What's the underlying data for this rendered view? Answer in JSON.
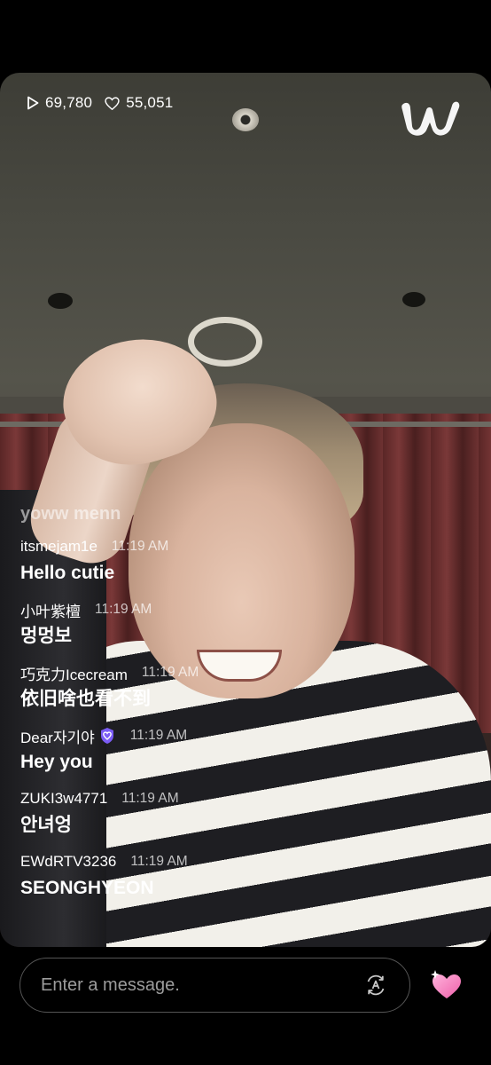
{
  "stats": {
    "views": "69,780",
    "likes": "55,051"
  },
  "chat": {
    "faded_message": "yoww menn",
    "messages": [
      {
        "user": "itsmejam1e",
        "time": "11:19 AM",
        "text": "Hello cutie"
      },
      {
        "user": "小叶紫檀",
        "time": "11:19 AM",
        "text": "멍멍보"
      },
      {
        "user": "巧克力Icecream",
        "time": "11:19 AM",
        "text": "依旧啥也看不到"
      },
      {
        "user": "Dear자기야",
        "time": "11:19 AM",
        "text": "Hey you",
        "badge": "heart-badge-icon"
      },
      {
        "user": "ZUKI3w4771",
        "time": "11:19 AM",
        "text": "안녀엉"
      },
      {
        "user": "EWdRTV3236",
        "time": "11:19 AM",
        "text": "SEONGHYEON"
      }
    ]
  },
  "input": {
    "placeholder": "Enter a message."
  },
  "icons": {
    "views": "play-icon",
    "likes": "heart-outline-icon",
    "logo": "weverse-logo-icon",
    "translate": "translate-icon",
    "send_heart": "sparkle-heart-icon"
  },
  "colors": {
    "heart_pink": "#f27ab8",
    "badge_purple": "#7b5cf5"
  }
}
